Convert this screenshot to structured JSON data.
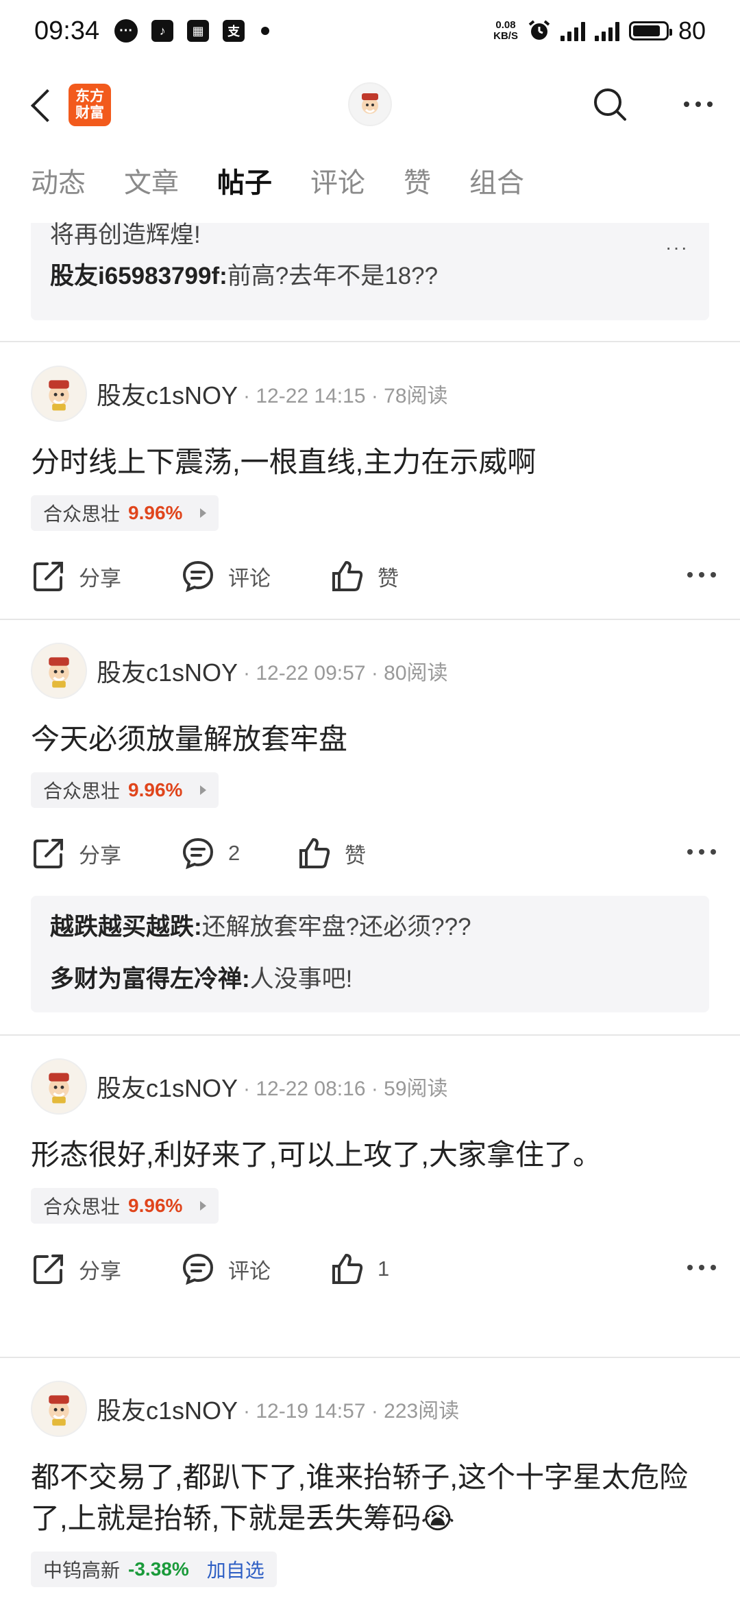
{
  "status_bar": {
    "time": "09:34",
    "net_speed_top": "0.08",
    "net_speed_bottom": "KB/S",
    "battery": "80",
    "battery_level": 0.85
  },
  "header": {
    "logo_line1": "东方",
    "logo_line2": "财富"
  },
  "tabs": [
    {
      "label": "动态",
      "active": false
    },
    {
      "label": "文章",
      "active": false
    },
    {
      "label": "帖子",
      "active": true
    },
    {
      "label": "评论",
      "active": false
    },
    {
      "label": "赞",
      "active": false
    },
    {
      "label": "组合",
      "active": false
    }
  ],
  "top_comment": {
    "text": "将再创造辉煌!",
    "reply_user": "股友i65983799f",
    "reply_text": "前高?去年不是18??"
  },
  "posts": [
    {
      "user": "股友c1sNOY",
      "meta": "· 12-22 14:15 · 78阅读",
      "text": "分时线上下震荡,一根直线,主力在示威啊",
      "stock_name": "合众思壮",
      "stock_pct": "9.96%",
      "share": "分享",
      "comment": "评论",
      "like": "赞"
    },
    {
      "user": "股友c1sNOY",
      "meta": "· 12-22 09:57 · 80阅读",
      "text": "今天必须放量解放套牢盘",
      "stock_name": "合众思壮",
      "stock_pct": "9.96%",
      "share": "分享",
      "comment": "2",
      "like": "赞",
      "replies": [
        {
          "user": "越跌越买越跌",
          "text": "还解放套牢盘?还必须???"
        },
        {
          "user": "多财为富得左冷禅",
          "text": "人没事吧!"
        }
      ]
    },
    {
      "user": "股友c1sNOY",
      "meta": "· 12-22 08:16 · 59阅读",
      "text": "形态很好,利好来了,可以上攻了,大家拿住了。",
      "stock_name": "合众思壮",
      "stock_pct": "9.96%",
      "share": "分享",
      "comment": "评论",
      "like": "1"
    },
    {
      "user": "股友c1sNOY",
      "meta": "· 12-19 14:57 · 223阅读",
      "text": "都不交易了,都趴下了,谁来抬轿子,这个十字星太危险了,上就是抬轿,下就是丢失筹码😭",
      "stock_name": "中钨高新",
      "stock_pct": "-3.38%",
      "add_watch": "加自选"
    }
  ],
  "colors": {
    "accent": "#f25a1c",
    "up": "#e0451c",
    "down": "#1a9a3a",
    "link": "#2d5ec4"
  }
}
